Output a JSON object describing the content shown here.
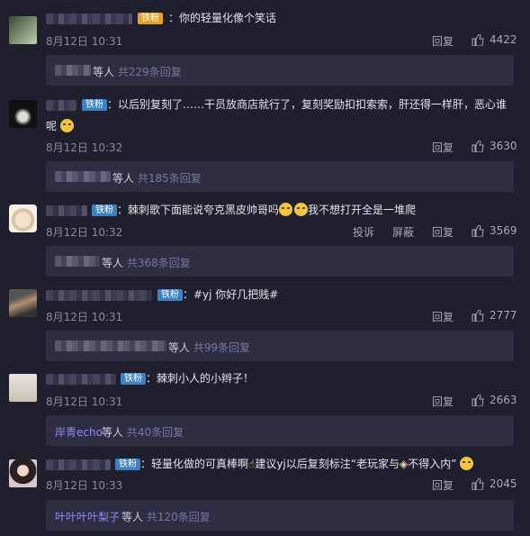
{
  "colors": {
    "background": "#1f1f2e",
    "reply_box": "#2e2d41",
    "badge": "#3b82c4",
    "reply_link": "#8d8df0"
  },
  "comments": [
    {
      "avatar_icon": "avatar-image",
      "badge": "铁粉",
      "text": "：你的轻量化像个笑话",
      "date": "8月12日 10:31",
      "reply": "回复",
      "likes": "4422",
      "thread": {
        "name": "",
        "suffix": "等人 ",
        "count": "共229条回复"
      }
    },
    {
      "avatar_icon": "avatar-image",
      "badge": "铁粉",
      "text": "：以后别复刻了……干员放商店就行了，复刻奖励扣扣索索，肝还得一样肝，恶心谁",
      "text2": "呢",
      "date": "8月12日 10:32",
      "reply": "回复",
      "likes": "3630",
      "thread": {
        "name": "",
        "suffix": "等人 ",
        "count": "共185条回复"
      }
    },
    {
      "avatar_icon": "avatar-image",
      "badge": "铁粉",
      "text": "：棘刺歌下面能说夸克黑皮帅哥吗",
      "text_after": "我不想打开全是一堆爬",
      "date": "8月12日 10:32",
      "report": "投诉",
      "block": "屏蔽",
      "reply": "回复",
      "likes": "3569",
      "thread": {
        "name": "",
        "suffix": "等人 ",
        "count": "共368条回复"
      }
    },
    {
      "avatar_icon": "avatar-image",
      "badge": "铁粉",
      "text": "：#yj 你好几把贱#",
      "date": "8月12日 10:31",
      "reply": "回复",
      "likes": "2777",
      "thread": {
        "name": "",
        "suffix": "等人 ",
        "count": "共99条回复"
      }
    },
    {
      "avatar_icon": "avatar-image",
      "badge": "铁粉",
      "text": "：棘刺小人的小辫子！",
      "date": "8月12日 10:31",
      "reply": "回复",
      "likes": "2663",
      "thread": {
        "name": "岸青echo",
        "suffix": " 等人 ",
        "count": "共40条回复"
      }
    },
    {
      "avatar_icon": "avatar-image",
      "badge": "铁粉",
      "text": "：轻量化做的可真棒啊",
      "text_mid": "建议yj以后复刻标注“老玩家与",
      "text_end": "不得入内”",
      "date": "8月12日 10:33",
      "reply": "回复",
      "likes": "2045",
      "thread": {
        "name": "叶叶叶叶梨子",
        "suffix": " 等人 ",
        "count": "共120条回复"
      }
    }
  ]
}
